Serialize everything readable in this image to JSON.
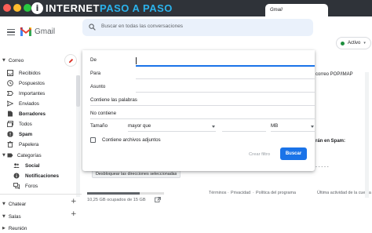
{
  "browser": {
    "brand_part1": "INTERNET",
    "brand_part2": "PASO A PASO",
    "brand_logo_letter": "i",
    "tab_label": "Gmail"
  },
  "header": {
    "app_name": "Gmail",
    "search_placeholder": "Buscar en todas las conversaciones",
    "status_label": "Activo",
    "status_color": "#1e8e3e"
  },
  "sidebar": {
    "mail_section": "Correo",
    "items": [
      {
        "label": "Recibidos",
        "icon": "inbox-icon",
        "bold": false
      },
      {
        "label": "Pospuestos",
        "icon": "clock-icon",
        "bold": false
      },
      {
        "label": "Importantes",
        "icon": "important-icon",
        "bold": false
      },
      {
        "label": "Enviados",
        "icon": "send-icon",
        "bold": false
      },
      {
        "label": "Borradores",
        "icon": "draft-icon",
        "bold": true
      },
      {
        "label": "Todos",
        "icon": "all-mail-icon",
        "bold": false
      },
      {
        "label": "Spam",
        "icon": "spam-icon",
        "bold": true
      },
      {
        "label": "Papelera",
        "icon": "trash-icon",
        "bold": false
      }
    ],
    "categories_label": "Categorías",
    "categories": [
      {
        "label": "Social",
        "icon": "people-icon",
        "bold": true
      },
      {
        "label": "Notificaciones",
        "icon": "info-icon",
        "bold": true
      },
      {
        "label": "Foros",
        "icon": "forum-icon",
        "bold": false
      }
    ],
    "chat_section": "Chatear",
    "rooms_section": "Salas",
    "meeting_section": "Reunión"
  },
  "background": {
    "tab_text": "correo POP/IMAP",
    "spam_text": "rán en Spam:",
    "unblock_button": "Desbloquear las direcciones seleccionadas",
    "storage_text": "10,25 GB ocupados de 15 GB",
    "storage_fraction": 0.68,
    "footer_links": [
      "Términos",
      "Privacidad",
      "Política del programa"
    ],
    "last_activity": "Última actividad de la cuenta"
  },
  "search_panel": {
    "fields": [
      {
        "label": "De",
        "focused": true
      },
      {
        "label": "Para",
        "focused": false
      },
      {
        "label": "Asunto",
        "focused": false
      },
      {
        "label": "Contiene las palabras",
        "focused": false
      },
      {
        "label": "No contiene",
        "focused": false
      }
    ],
    "size_label": "Tamaño",
    "size_operator": "mayor que",
    "size_unit": "MB",
    "attachments_label": "Contiene archivos adjuntos",
    "filter_button": "Crear filtro",
    "search_button": "Buscar",
    "accent_color": "#1a73e8"
  }
}
